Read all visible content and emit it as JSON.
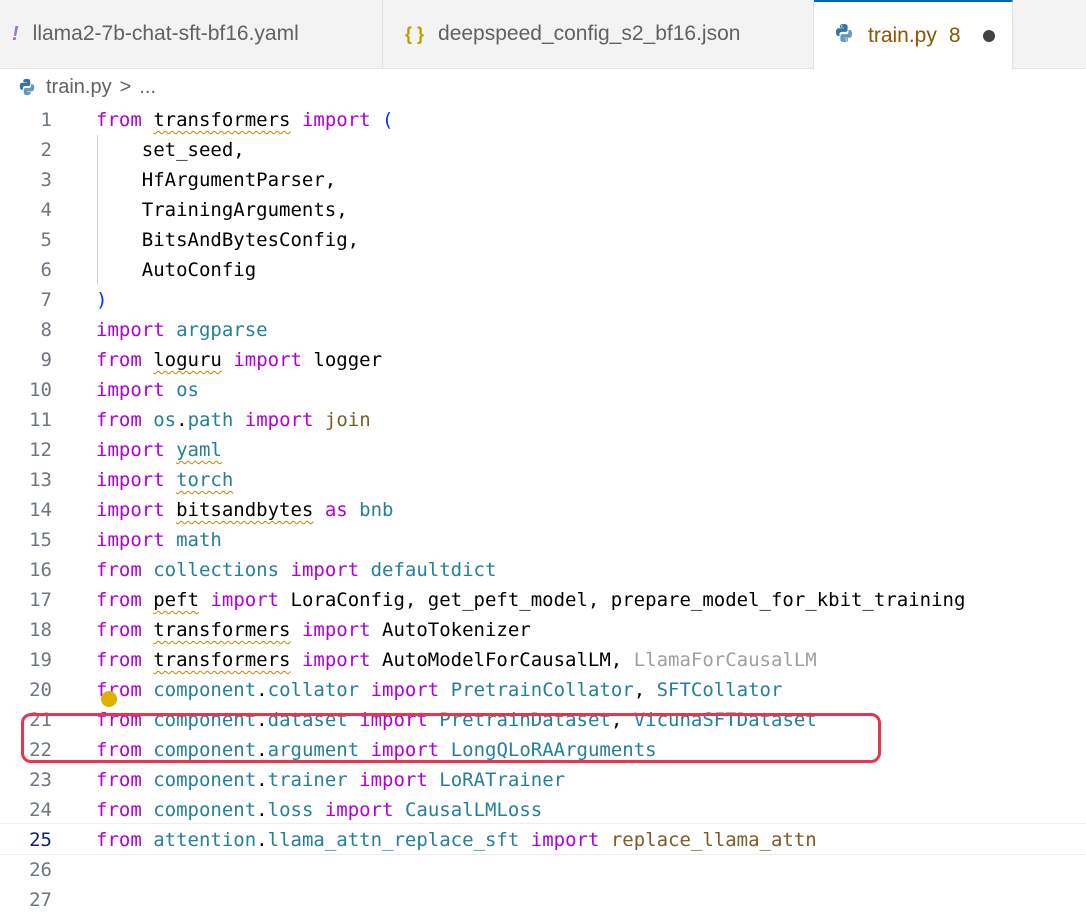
{
  "tabs": [
    {
      "label": "llama2-7b-chat-sft-bf16.yaml",
      "icon": "!",
      "icon_name": "yaml-icon",
      "icon_color": "#a074c4"
    },
    {
      "label": "deepspeed_config_s2_bf16.json",
      "icon": "{}",
      "icon_name": "json-icon",
      "icon_color": "#cbcb41"
    },
    {
      "label": "train.py",
      "icon": "py",
      "icon_name": "python-icon",
      "icon_color": "#3572a5",
      "problem_count": "8",
      "modified": true
    }
  ],
  "breadcrumb": {
    "file": "train.py",
    "separator": ">",
    "rest": "..."
  },
  "current_line": 25,
  "lines": [
    [
      [
        "kw",
        "from"
      ],
      [
        "plain",
        " "
      ],
      [
        "plain sq",
        "transformers"
      ],
      [
        "plain",
        " "
      ],
      [
        "kw",
        "import"
      ],
      [
        "plain",
        " "
      ],
      [
        "paren",
        "("
      ]
    ],
    [
      [
        "plain",
        "    set_seed,"
      ]
    ],
    [
      [
        "plain",
        "    HfArgumentParser,"
      ]
    ],
    [
      [
        "plain",
        "    TrainingArguments,"
      ]
    ],
    [
      [
        "plain",
        "    BitsAndBytesConfig,"
      ]
    ],
    [
      [
        "plain",
        "    AutoConfig"
      ]
    ],
    [
      [
        "paren",
        ")"
      ]
    ],
    [
      [
        "kw",
        "import"
      ],
      [
        "plain",
        " "
      ],
      [
        "mod",
        "argparse"
      ]
    ],
    [
      [
        "kw",
        "from"
      ],
      [
        "plain",
        " "
      ],
      [
        "plain sq",
        "loguru"
      ],
      [
        "plain",
        " "
      ],
      [
        "kw",
        "import"
      ],
      [
        "plain",
        " logger"
      ]
    ],
    [
      [
        "kw",
        "import"
      ],
      [
        "plain",
        " "
      ],
      [
        "mod",
        "os"
      ]
    ],
    [
      [
        "kw",
        "from"
      ],
      [
        "plain",
        " "
      ],
      [
        "mod",
        "os"
      ],
      [
        "plain",
        "."
      ],
      [
        "mod",
        "path"
      ],
      [
        "plain",
        " "
      ],
      [
        "kw",
        "import"
      ],
      [
        "plain",
        " "
      ],
      [
        "fn",
        "join"
      ]
    ],
    [
      [
        "kw",
        "import"
      ],
      [
        "plain",
        " "
      ],
      [
        "mod sq",
        "yaml"
      ]
    ],
    [
      [
        "kw",
        "import"
      ],
      [
        "plain",
        " "
      ],
      [
        "mod sq",
        "torch"
      ]
    ],
    [
      [
        "kw",
        "import"
      ],
      [
        "plain",
        " "
      ],
      [
        "plain sq",
        "bitsandbytes"
      ],
      [
        "plain",
        " "
      ],
      [
        "kw",
        "as"
      ],
      [
        "plain",
        " "
      ],
      [
        "mod",
        "bnb"
      ]
    ],
    [
      [
        "kw",
        "import"
      ],
      [
        "plain",
        " "
      ],
      [
        "mod",
        "math"
      ]
    ],
    [
      [
        "kw",
        "from"
      ],
      [
        "plain",
        " "
      ],
      [
        "mod",
        "collections"
      ],
      [
        "plain",
        " "
      ],
      [
        "kw",
        "import"
      ],
      [
        "plain",
        " "
      ],
      [
        "mod",
        "defaultdict"
      ]
    ],
    [
      [
        "kw",
        "from"
      ],
      [
        "plain",
        " "
      ],
      [
        "plain sq",
        "peft"
      ],
      [
        "plain",
        " "
      ],
      [
        "kw",
        "import"
      ],
      [
        "plain",
        " LoraConfig, get_peft_model, prepare_model_for_kbit_training"
      ]
    ],
    [
      [
        "kw",
        "from"
      ],
      [
        "plain",
        " "
      ],
      [
        "plain sq",
        "transformers"
      ],
      [
        "plain",
        " "
      ],
      [
        "kw",
        "import"
      ],
      [
        "plain",
        " AutoTokenizer"
      ]
    ],
    [
      [
        "kw",
        "from"
      ],
      [
        "plain",
        " "
      ],
      [
        "plain sq",
        "transformers"
      ],
      [
        "plain",
        " "
      ],
      [
        "kw",
        "import"
      ],
      [
        "plain",
        " AutoModelForCausalLM, "
      ],
      [
        "dim",
        "LlamaForCausalLM"
      ]
    ],
    [
      [
        "kw",
        "from"
      ],
      [
        "plain",
        " "
      ],
      [
        "mod",
        "component"
      ],
      [
        "plain",
        "."
      ],
      [
        "mod",
        "collator"
      ],
      [
        "plain",
        " "
      ],
      [
        "kw",
        "import"
      ],
      [
        "plain",
        " "
      ],
      [
        "mod",
        "PretrainCollator"
      ],
      [
        "plain",
        ", "
      ],
      [
        "mod",
        "SFTCollator"
      ]
    ],
    [
      [
        "kw",
        "from"
      ],
      [
        "plain",
        " "
      ],
      [
        "mod",
        "component"
      ],
      [
        "plain",
        "."
      ],
      [
        "mod",
        "dataset"
      ],
      [
        "plain",
        " "
      ],
      [
        "kw",
        "import"
      ],
      [
        "plain",
        " "
      ],
      [
        "mod",
        "PretrainDataset"
      ],
      [
        "plain",
        ", "
      ],
      [
        "mod",
        "VicunaSFTDataset"
      ]
    ],
    [
      [
        "kw",
        "from"
      ],
      [
        "plain",
        " "
      ],
      [
        "mod",
        "component"
      ],
      [
        "plain",
        "."
      ],
      [
        "mod",
        "argument"
      ],
      [
        "plain",
        " "
      ],
      [
        "kw",
        "import"
      ],
      [
        "plain",
        " "
      ],
      [
        "mod",
        "LongQLoRAArguments"
      ]
    ],
    [
      [
        "kw",
        "from"
      ],
      [
        "plain",
        " "
      ],
      [
        "mod",
        "component"
      ],
      [
        "plain",
        "."
      ],
      [
        "mod",
        "trainer"
      ],
      [
        "plain",
        " "
      ],
      [
        "kw",
        "import"
      ],
      [
        "plain",
        " "
      ],
      [
        "mod",
        "LoRATrainer"
      ]
    ],
    [
      [
        "kw",
        "from"
      ],
      [
        "plain",
        " "
      ],
      [
        "mod",
        "component"
      ],
      [
        "plain",
        "."
      ],
      [
        "mod",
        "loss"
      ],
      [
        "plain",
        " "
      ],
      [
        "kw",
        "import"
      ],
      [
        "plain",
        " "
      ],
      [
        "mod",
        "CausalLMLoss"
      ]
    ],
    [
      [
        "kw",
        "from"
      ],
      [
        "plain",
        " "
      ],
      [
        "mod",
        "attention"
      ],
      [
        "plain",
        "."
      ],
      [
        "mod",
        "llama_attn_replace_sft"
      ],
      [
        "plain",
        " "
      ],
      [
        "kw",
        "import"
      ],
      [
        "plain",
        " "
      ],
      [
        "fn",
        "replace_llama_attn"
      ]
    ],
    [],
    []
  ]
}
